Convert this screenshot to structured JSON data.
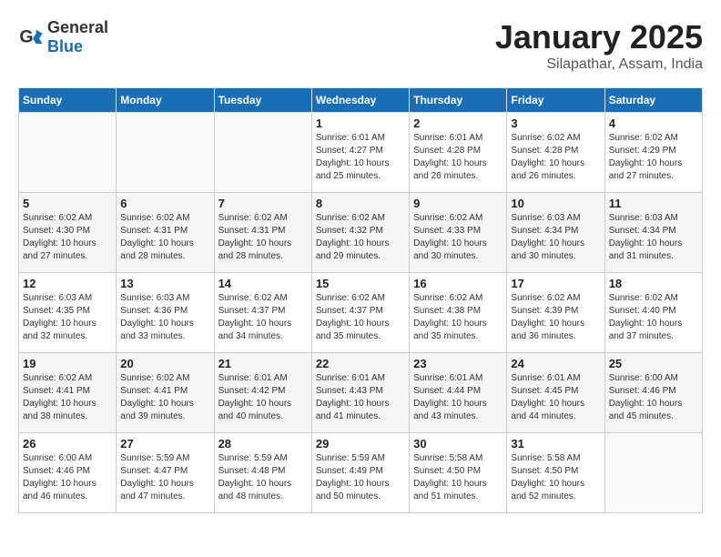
{
  "header": {
    "logo_general": "General",
    "logo_blue": "Blue",
    "month": "January 2025",
    "location": "Silapathar, Assam, India"
  },
  "days_of_week": [
    "Sunday",
    "Monday",
    "Tuesday",
    "Wednesday",
    "Thursday",
    "Friday",
    "Saturday"
  ],
  "weeks": [
    [
      {
        "day": "",
        "info": ""
      },
      {
        "day": "",
        "info": ""
      },
      {
        "day": "",
        "info": ""
      },
      {
        "day": "1",
        "info": "Sunrise: 6:01 AM\nSunset: 4:27 PM\nDaylight: 10 hours\nand 25 minutes."
      },
      {
        "day": "2",
        "info": "Sunrise: 6:01 AM\nSunset: 4:28 PM\nDaylight: 10 hours\nand 26 minutes."
      },
      {
        "day": "3",
        "info": "Sunrise: 6:02 AM\nSunset: 4:28 PM\nDaylight: 10 hours\nand 26 minutes."
      },
      {
        "day": "4",
        "info": "Sunrise: 6:02 AM\nSunset: 4:29 PM\nDaylight: 10 hours\nand 27 minutes."
      }
    ],
    [
      {
        "day": "5",
        "info": "Sunrise: 6:02 AM\nSunset: 4:30 PM\nDaylight: 10 hours\nand 27 minutes."
      },
      {
        "day": "6",
        "info": "Sunrise: 6:02 AM\nSunset: 4:31 PM\nDaylight: 10 hours\nand 28 minutes."
      },
      {
        "day": "7",
        "info": "Sunrise: 6:02 AM\nSunset: 4:31 PM\nDaylight: 10 hours\nand 28 minutes."
      },
      {
        "day": "8",
        "info": "Sunrise: 6:02 AM\nSunset: 4:32 PM\nDaylight: 10 hours\nand 29 minutes."
      },
      {
        "day": "9",
        "info": "Sunrise: 6:02 AM\nSunset: 4:33 PM\nDaylight: 10 hours\nand 30 minutes."
      },
      {
        "day": "10",
        "info": "Sunrise: 6:03 AM\nSunset: 4:34 PM\nDaylight: 10 hours\nand 30 minutes."
      },
      {
        "day": "11",
        "info": "Sunrise: 6:03 AM\nSunset: 4:34 PM\nDaylight: 10 hours\nand 31 minutes."
      }
    ],
    [
      {
        "day": "12",
        "info": "Sunrise: 6:03 AM\nSunset: 4:35 PM\nDaylight: 10 hours\nand 32 minutes."
      },
      {
        "day": "13",
        "info": "Sunrise: 6:03 AM\nSunset: 4:36 PM\nDaylight: 10 hours\nand 33 minutes."
      },
      {
        "day": "14",
        "info": "Sunrise: 6:02 AM\nSunset: 4:37 PM\nDaylight: 10 hours\nand 34 minutes."
      },
      {
        "day": "15",
        "info": "Sunrise: 6:02 AM\nSunset: 4:37 PM\nDaylight: 10 hours\nand 35 minutes."
      },
      {
        "day": "16",
        "info": "Sunrise: 6:02 AM\nSunset: 4:38 PM\nDaylight: 10 hours\nand 35 minutes."
      },
      {
        "day": "17",
        "info": "Sunrise: 6:02 AM\nSunset: 4:39 PM\nDaylight: 10 hours\nand 36 minutes."
      },
      {
        "day": "18",
        "info": "Sunrise: 6:02 AM\nSunset: 4:40 PM\nDaylight: 10 hours\nand 37 minutes."
      }
    ],
    [
      {
        "day": "19",
        "info": "Sunrise: 6:02 AM\nSunset: 4:41 PM\nDaylight: 10 hours\nand 38 minutes."
      },
      {
        "day": "20",
        "info": "Sunrise: 6:02 AM\nSunset: 4:41 PM\nDaylight: 10 hours\nand 39 minutes."
      },
      {
        "day": "21",
        "info": "Sunrise: 6:01 AM\nSunset: 4:42 PM\nDaylight: 10 hours\nand 40 minutes."
      },
      {
        "day": "22",
        "info": "Sunrise: 6:01 AM\nSunset: 4:43 PM\nDaylight: 10 hours\nand 41 minutes."
      },
      {
        "day": "23",
        "info": "Sunrise: 6:01 AM\nSunset: 4:44 PM\nDaylight: 10 hours\nand 43 minutes."
      },
      {
        "day": "24",
        "info": "Sunrise: 6:01 AM\nSunset: 4:45 PM\nDaylight: 10 hours\nand 44 minutes."
      },
      {
        "day": "25",
        "info": "Sunrise: 6:00 AM\nSunset: 4:46 PM\nDaylight: 10 hours\nand 45 minutes."
      }
    ],
    [
      {
        "day": "26",
        "info": "Sunrise: 6:00 AM\nSunset: 4:46 PM\nDaylight: 10 hours\nand 46 minutes."
      },
      {
        "day": "27",
        "info": "Sunrise: 5:59 AM\nSunset: 4:47 PM\nDaylight: 10 hours\nand 47 minutes."
      },
      {
        "day": "28",
        "info": "Sunrise: 5:59 AM\nSunset: 4:48 PM\nDaylight: 10 hours\nand 48 minutes."
      },
      {
        "day": "29",
        "info": "Sunrise: 5:59 AM\nSunset: 4:49 PM\nDaylight: 10 hours\nand 50 minutes."
      },
      {
        "day": "30",
        "info": "Sunrise: 5:58 AM\nSunset: 4:50 PM\nDaylight: 10 hours\nand 51 minutes."
      },
      {
        "day": "31",
        "info": "Sunrise: 5:58 AM\nSunset: 4:50 PM\nDaylight: 10 hours\nand 52 minutes."
      },
      {
        "day": "",
        "info": ""
      }
    ]
  ]
}
